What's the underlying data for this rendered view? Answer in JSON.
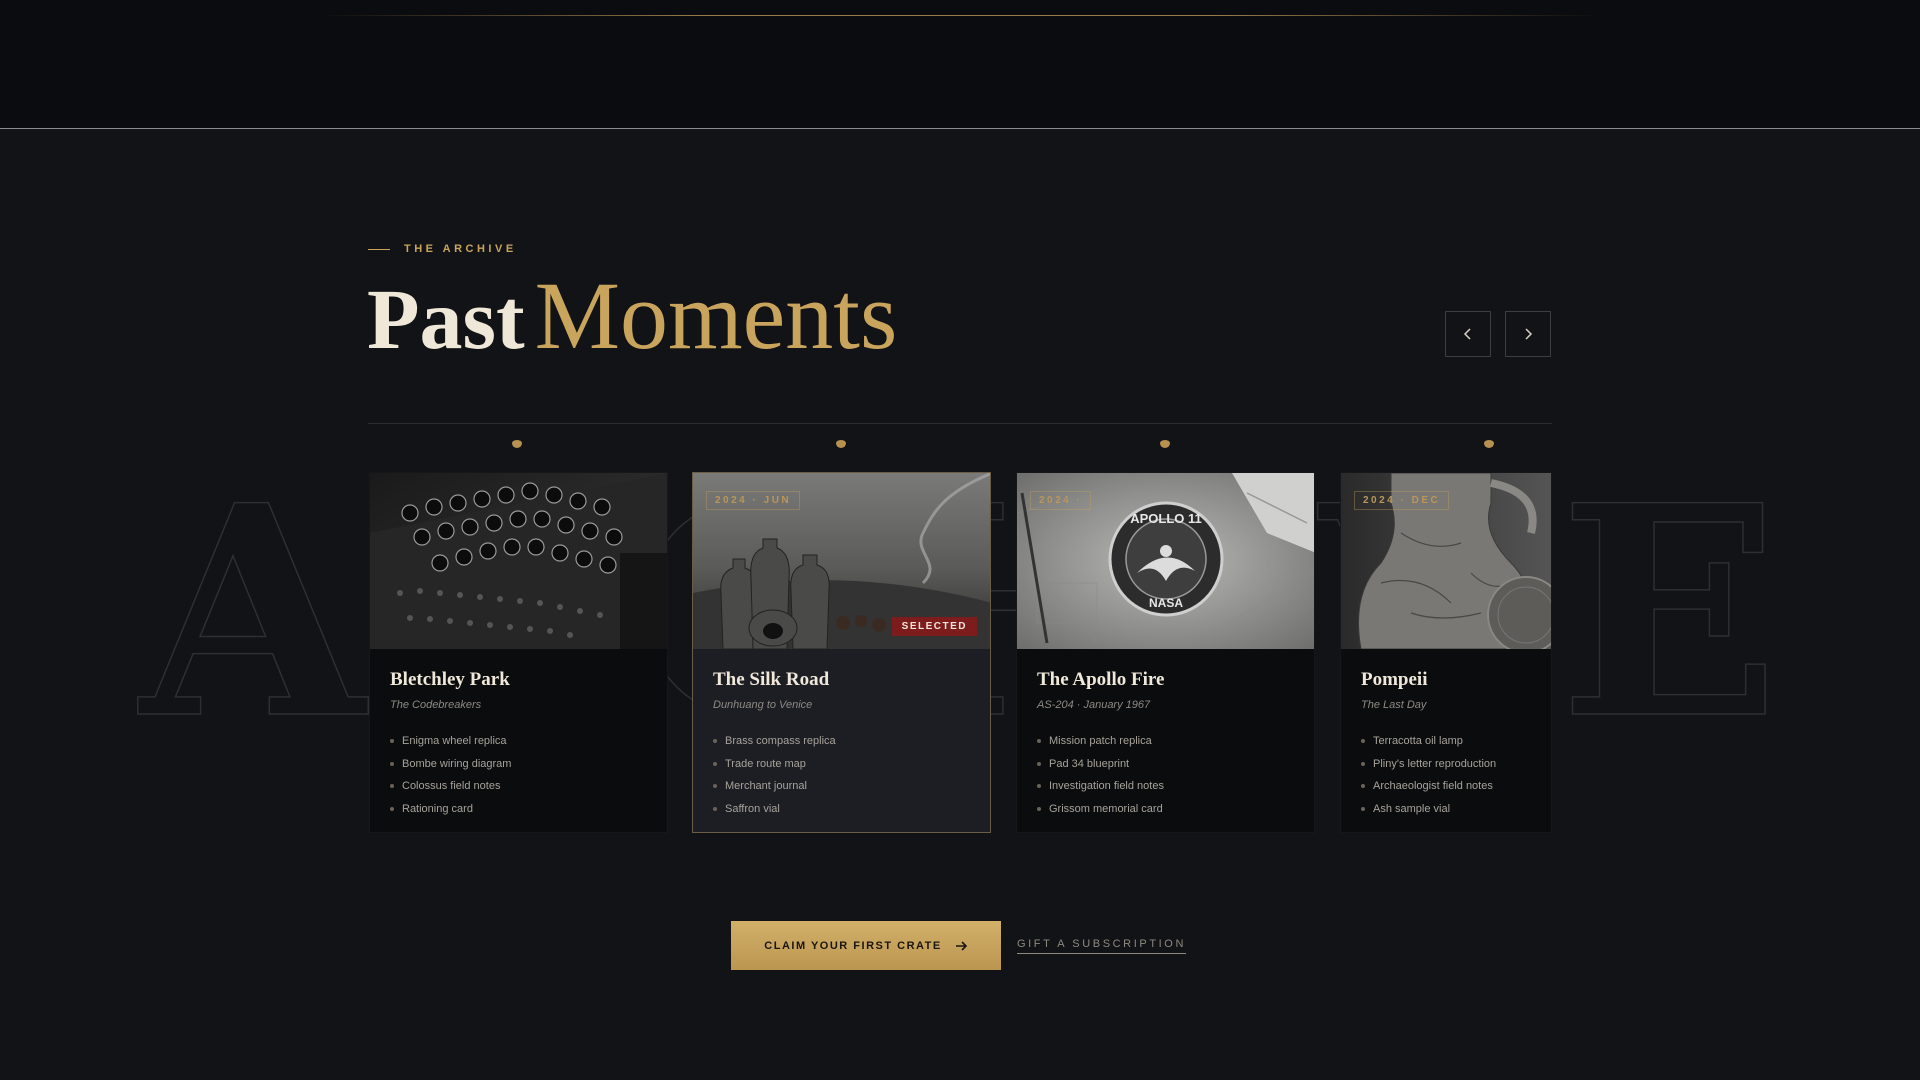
{
  "section": {
    "eyebrow": "THE ARCHIVE",
    "title_plain": "Past",
    "title_accent": "Moments",
    "background_word": [
      "A",
      "R",
      "C",
      "H",
      "I",
      "V",
      "E"
    ]
  },
  "nav": {
    "prev_icon": "chevron-left-icon",
    "next_icon": "chevron-right-icon"
  },
  "cards": [
    {
      "image": "enigma-machine-photo",
      "date": "",
      "title": "Bletchley Park",
      "subtitle": "The Codebreakers",
      "items": [
        "Enigma wheel replica",
        "Bombe wiring diagram",
        "Colossus field notes",
        "Rationing card"
      ]
    },
    {
      "image": "silk-road-jars-photo",
      "date": "2024 · JUN",
      "badge": "SELECTED",
      "title": "The Silk Road",
      "subtitle": "Dunhuang to Venice",
      "items": [
        "Brass compass replica",
        "Trade route map",
        "Merchant journal",
        "Saffron vial"
      ]
    },
    {
      "image": "apollo-11-patch-photo",
      "date": "2024 · ",
      "patch_text_top": "APOLLO 11",
      "patch_text_bottom": "NASA",
      "title": "The Apollo Fire",
      "subtitle": "AS-204 · January 1967",
      "items": [
        "Mission patch replica",
        "Pad 34 blueprint",
        "Investigation field notes",
        "Grissom memorial card"
      ]
    },
    {
      "image": "pompeii-amphora-photo",
      "date": "2024 · DEC",
      "title": "Pompeii",
      "subtitle": "The Last Day",
      "items": [
        "Terracotta oil lamp",
        "Pliny's letter reproduction",
        "Archaeologist field notes",
        "Ash sample vial"
      ]
    }
  ],
  "cta": {
    "primary": "CLAIM YOUR FIRST CRATE",
    "primary_icon": "arrow-right-icon",
    "secondary": "GIFT A SUBSCRIPTION"
  },
  "colors": {
    "accent": "#c9a45c",
    "background": "#121316",
    "badge": "#7c1c1c"
  }
}
